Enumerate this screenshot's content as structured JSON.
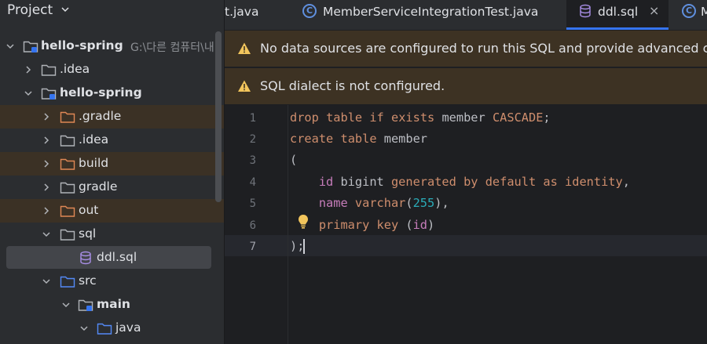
{
  "project_panel": {
    "title": "Project",
    "tree": [
      {
        "label": "hello-spring",
        "path": "G:\\다른 컴퓨터\\내"
      },
      {
        "label": ".idea"
      },
      {
        "label": "hello-spring"
      },
      {
        "label": ".gradle"
      },
      {
        "label": ".idea"
      },
      {
        "label": "build"
      },
      {
        "label": "gradle"
      },
      {
        "label": "out"
      },
      {
        "label": "sql"
      },
      {
        "label": "ddl.sql"
      },
      {
        "label": "src"
      },
      {
        "label": "main"
      },
      {
        "label": "java"
      }
    ]
  },
  "tabs": [
    {
      "label": "t.java"
    },
    {
      "label": "MemberServiceIntegrationTest.java",
      "icon_letter": "C"
    },
    {
      "label": "ddl.sql",
      "active": true
    },
    {
      "label": "M",
      "icon_letter": "C"
    }
  ],
  "tab_close_glyph": "×",
  "banners": [
    {
      "text": "No data sources are configured to run this SQL and provide advanced code"
    },
    {
      "text": "SQL dialect is not configured."
    }
  ],
  "editor": {
    "line_numbers": [
      "1",
      "2",
      "3",
      "4",
      "5",
      "6",
      "7"
    ],
    "lines": [
      [
        {
          "t": "drop",
          "c": "kw"
        },
        {
          "t": " "
        },
        {
          "t": "table",
          "c": "kw"
        },
        {
          "t": " "
        },
        {
          "t": "if",
          "c": "kw"
        },
        {
          "t": " "
        },
        {
          "t": "exists",
          "c": "kw"
        },
        {
          "t": " member "
        },
        {
          "t": "CASCADE",
          "c": "kw"
        },
        {
          "t": ";"
        }
      ],
      [
        {
          "t": "create",
          "c": "kw"
        },
        {
          "t": " "
        },
        {
          "t": "table",
          "c": "kw"
        },
        {
          "t": " member"
        }
      ],
      [
        {
          "t": "("
        }
      ],
      [
        {
          "t": "    "
        },
        {
          "t": "id",
          "c": "fld"
        },
        {
          "t": " bigint "
        },
        {
          "t": "generated",
          "c": "kw"
        },
        {
          "t": " "
        },
        {
          "t": "by",
          "c": "kw"
        },
        {
          "t": " "
        },
        {
          "t": "default",
          "c": "kw"
        },
        {
          "t": " "
        },
        {
          "t": "as",
          "c": "kw"
        },
        {
          "t": " "
        },
        {
          "t": "identity",
          "c": "kw"
        },
        {
          "t": ","
        }
      ],
      [
        {
          "t": "    "
        },
        {
          "t": "name",
          "c": "fld"
        },
        {
          "t": " "
        },
        {
          "t": "varchar",
          "c": "kw"
        },
        {
          "t": "("
        },
        {
          "t": "255",
          "c": "num"
        },
        {
          "t": "),"
        }
      ],
      [
        {
          "t": "    "
        },
        {
          "t": "primary",
          "c": "kw"
        },
        {
          "t": " "
        },
        {
          "t": "key",
          "c": "kw"
        },
        {
          "t": " ("
        },
        {
          "t": "id",
          "c": "fld"
        },
        {
          "t": ")"
        }
      ],
      [
        {
          "t": ");"
        }
      ]
    ],
    "current_line": 7
  },
  "colors": {
    "keyword": "#cf8e6d",
    "field": "#c77dbb",
    "number": "#2aacb8",
    "accent": "#3574f0",
    "warning_banner": "#3d3223"
  }
}
